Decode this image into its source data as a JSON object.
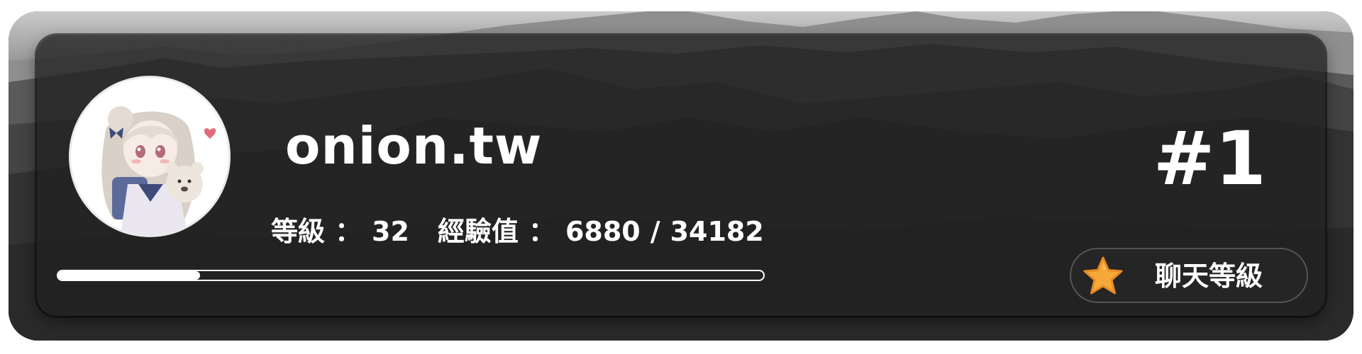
{
  "profile": {
    "username": "onion.tw",
    "rank": "#1"
  },
  "stats": {
    "level_label": "等級",
    "level_value": "32",
    "exp_label": "經驗值",
    "colon": "：",
    "exp_current": "6880",
    "exp_separator": "/",
    "exp_total": "34182"
  },
  "progress": {
    "fraction": 0.2013
  },
  "actions": {
    "chat_level_label": "聊天等級"
  },
  "icons": {
    "star": "star-icon"
  },
  "colors": {
    "text": "#ffffff",
    "star_fill": "#f4a93a",
    "panel": "#202020"
  }
}
